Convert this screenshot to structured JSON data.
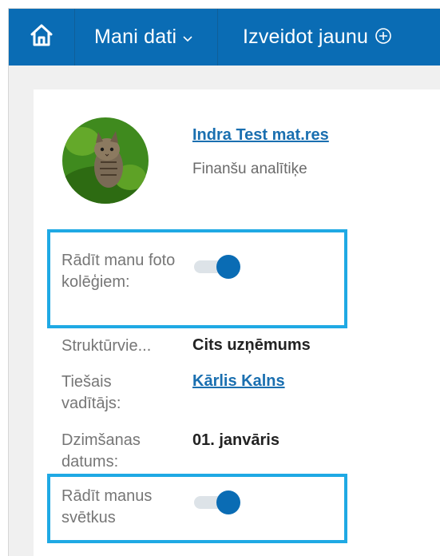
{
  "nav": {
    "home_icon": "home-icon",
    "my_data_label": "Mani dati",
    "create_new_label": "Izveidot jaunu"
  },
  "profile": {
    "name": "Indra Test mat.res",
    "role": "Finanšu analītiķe"
  },
  "settings": {
    "show_photo": {
      "label": "Rādīt manu foto kolēģiem:",
      "enabled": true
    },
    "department": {
      "label": "Struktūrvie...",
      "value": "Cits uzņēmums"
    },
    "manager": {
      "label": "Tiešais vadītājs:",
      "value": "Kārlis Kalns"
    },
    "birthday": {
      "label": "Dzimšanas datums:",
      "value": "01. janvāris"
    },
    "show_celebrations": {
      "label": "Rādīt manus svētkus",
      "enabled": true
    }
  },
  "colors": {
    "brand": "#0a6cb4",
    "highlight": "#1fa9e4",
    "link": "#1a6fb0"
  }
}
